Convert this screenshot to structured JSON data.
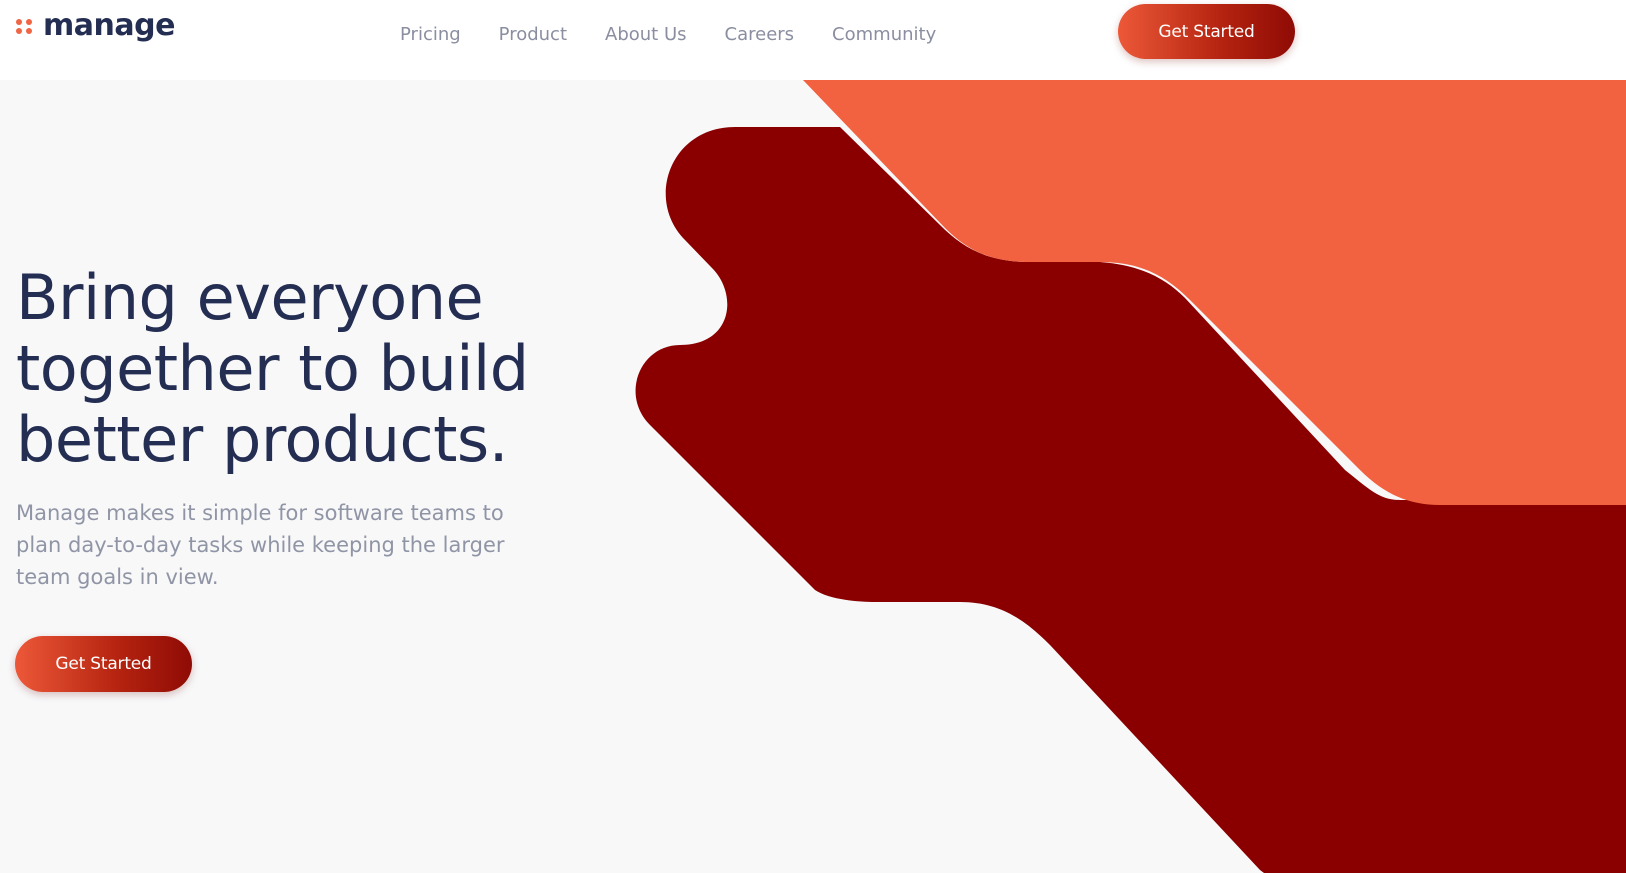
{
  "header": {
    "logo_text": "manage",
    "nav": [
      {
        "label": "Pricing"
      },
      {
        "label": "Product"
      },
      {
        "label": "About Us"
      },
      {
        "label": "Careers"
      },
      {
        "label": "Community"
      }
    ],
    "cta_label": "Get Started"
  },
  "hero": {
    "title_lines": [
      "Bring everyone",
      "together to build",
      "better products."
    ],
    "subtitle": "Manage makes it simple for software teams to plan day-to-day tasks while keeping the larger team goals in view.",
    "cta_label": "Get Started"
  },
  "colors": {
    "brand_dark": "#242d52",
    "accent_orange": "#f26140",
    "accent_dark_red": "#8a0000",
    "muted_text": "#9095a6",
    "background": "#f8f8f9"
  },
  "icons": [
    "logo-dots-icon"
  ]
}
